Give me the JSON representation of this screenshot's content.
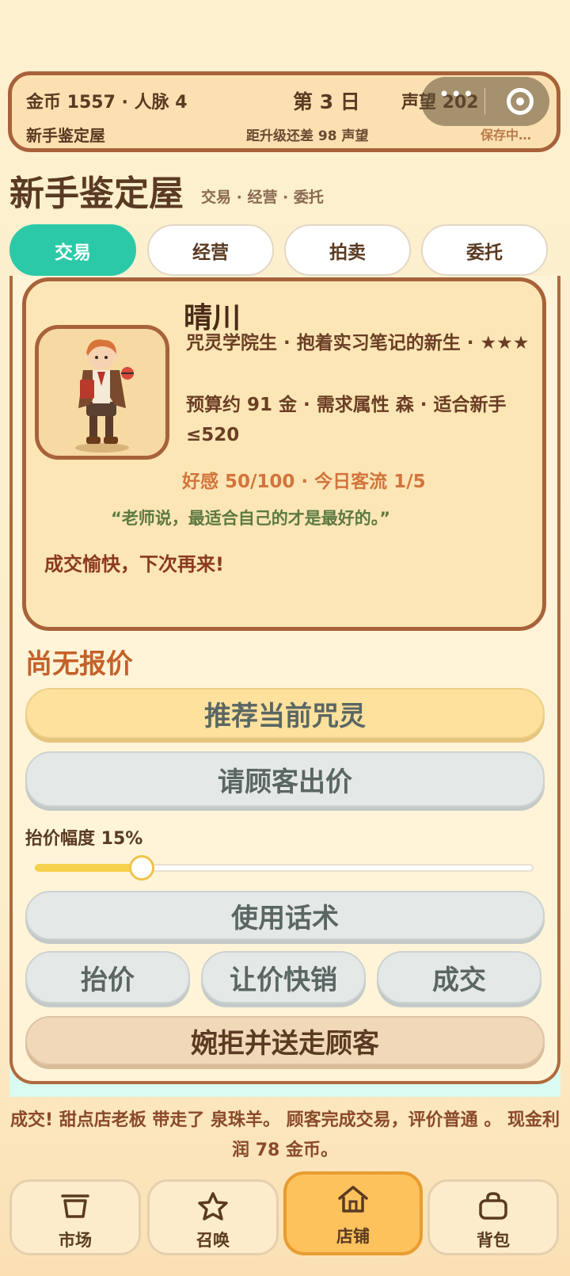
{
  "header": {
    "gold": "金币 1557 · 人脉 4",
    "day": "第 3 日",
    "reputation": "声望 202",
    "shop_name": "新手鉴定屋",
    "next_level": "距升级还差 98 声望",
    "saving": "保存中…"
  },
  "capsule": {
    "more_icon": "more-dots-icon",
    "close_icon": "target-close-icon"
  },
  "shop": {
    "title": "新手鉴定屋",
    "subtitle": "交易 · 经营 · 委托"
  },
  "tabs": [
    {
      "label": "交易",
      "active": true
    },
    {
      "label": "经营",
      "active": false
    },
    {
      "label": "拍卖",
      "active": false
    },
    {
      "label": "委托",
      "active": false
    }
  ],
  "customer": {
    "name": "晴川",
    "desc": "咒灵学院生 · 抱着实习笔记的新生 · ★★★",
    "budget": "预算约 91 金 · 需求属性 森 · 适合新手≤520",
    "favor": "好感 50/100 · 今日客流 1/5",
    "quote": "“老师说，最适合自己的才是最好的。”",
    "deal_text": "成交愉快，下次再来!"
  },
  "offer": {
    "status": "尚无报价",
    "recommend": "推荐当前咒灵",
    "ask_price": "请顾客出价",
    "raise_label": "抬价幅度 15%",
    "raise_percent": 15,
    "use_talk": "使用话术",
    "raise": "抬价",
    "discount": "让价快销",
    "deal": "成交",
    "decline": "婉拒并送走顾客"
  },
  "log": "成交! 甜点店老板 带走了 泉珠羊。 顾客完成交易，评价普通 。 现金利润 78 金币。",
  "nav": [
    {
      "label": "市场",
      "icon": "basket-icon",
      "active": false
    },
    {
      "label": "召唤",
      "icon": "star-icon",
      "active": false
    },
    {
      "label": "店铺",
      "icon": "house-icon",
      "active": true
    },
    {
      "label": "背包",
      "icon": "bag-icon",
      "active": false
    }
  ],
  "colors": {
    "accent": "#2cc9a9",
    "border": "#a8623a",
    "nav_active": "#fdc25c"
  }
}
